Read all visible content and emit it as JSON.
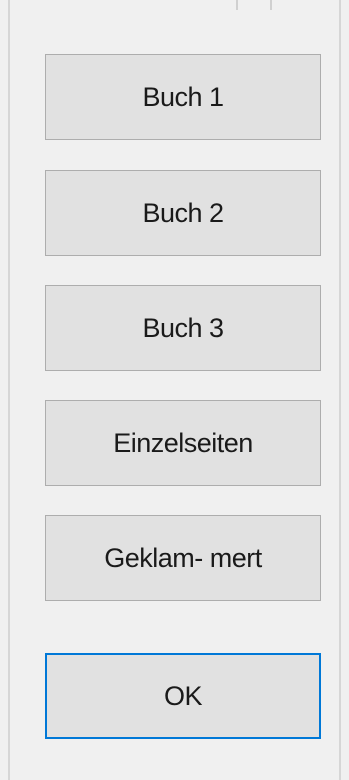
{
  "buttons": {
    "buch1": "Buch 1",
    "buch2": "Buch 2",
    "buch3": "Buch 3",
    "einzelseiten": "Einzelseiten",
    "geklammert": "Geklam- mert",
    "ok": "OK"
  },
  "colors": {
    "dialog_background": "#f0f0f0",
    "button_face": "#e1e1e1",
    "button_border": "#adadad",
    "focus_border": "#0078d7"
  }
}
